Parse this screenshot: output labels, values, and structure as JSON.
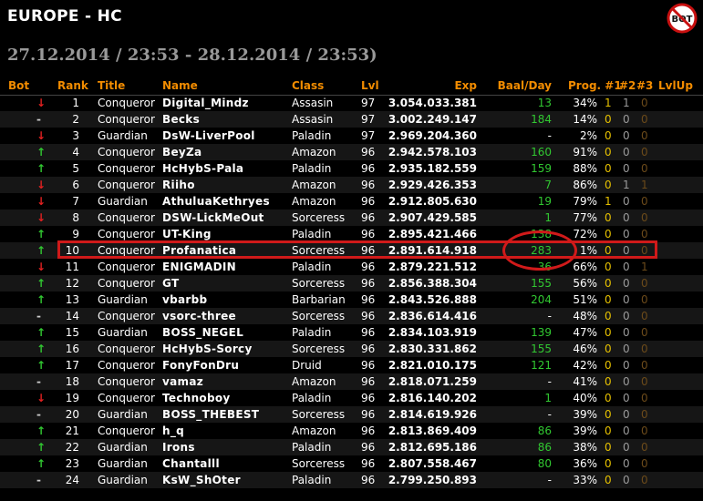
{
  "page": {
    "title": "EUROPE - HC",
    "date_range": "27.12.2014 / 23:53 - 28.12.2014 / 23:53)",
    "logo_text": "BOT",
    "logo_icon": "no-bot-icon"
  },
  "colors": {
    "header": "#f28c00",
    "up": "#31c831",
    "down": "#e02020",
    "baal": "#31c831",
    "highlight": "#d01a1a"
  },
  "table": {
    "headers": {
      "bot": "Bot",
      "rank": "Rank",
      "title": "Title",
      "name": "Name",
      "class": "Class",
      "lvl": "Lvl",
      "exp": "Exp",
      "baal_day": "Baal/Day",
      "prog1": "Prog. #1",
      "prog2": "#2",
      "prog3": "#3",
      "lvlup": "LvlUp"
    },
    "rows": [
      {
        "bot": "↓",
        "trend": "down",
        "rank": "1",
        "title": "Conqueror",
        "name": "Digital_Mindz",
        "class": "Assasin",
        "lvl": "97",
        "exp": "3.054.033.381",
        "baal": "13",
        "prog": "34%",
        "p1": "1",
        "p2": "1",
        "p3": "0"
      },
      {
        "bot": "-",
        "trend": "same",
        "rank": "2",
        "title": "Conqueror",
        "name": "Becks",
        "class": "Assasin",
        "lvl": "97",
        "exp": "3.002.249.147",
        "baal": "184",
        "prog": "14%",
        "p1": "0",
        "p2": "0",
        "p3": "0"
      },
      {
        "bot": "↓",
        "trend": "down",
        "rank": "3",
        "title": "Guardian",
        "name": "DsW-LiverPool",
        "class": "Paladin",
        "lvl": "97",
        "exp": "2.969.204.360",
        "baal": "-",
        "prog": "2%",
        "p1": "0",
        "p2": "0",
        "p3": "0"
      },
      {
        "bot": "↑",
        "trend": "up",
        "rank": "4",
        "title": "Conqueror",
        "name": "BeyZa",
        "class": "Amazon",
        "lvl": "96",
        "exp": "2.942.578.103",
        "baal": "160",
        "prog": "91%",
        "p1": "0",
        "p2": "0",
        "p3": "0"
      },
      {
        "bot": "↑",
        "trend": "up",
        "rank": "5",
        "title": "Conqueror",
        "name": "HcHybS-Pala",
        "class": "Paladin",
        "lvl": "96",
        "exp": "2.935.182.559",
        "baal": "159",
        "prog": "88%",
        "p1": "0",
        "p2": "0",
        "p3": "0"
      },
      {
        "bot": "↓",
        "trend": "down",
        "rank": "6",
        "title": "Conqueror",
        "name": "Riiho",
        "class": "Amazon",
        "lvl": "96",
        "exp": "2.929.426.353",
        "baal": "7",
        "prog": "86%",
        "p1": "0",
        "p2": "1",
        "p3": "1"
      },
      {
        "bot": "↓",
        "trend": "down",
        "rank": "7",
        "title": "Guardian",
        "name": "AthuluaKethryes",
        "class": "Amazon",
        "lvl": "96",
        "exp": "2.912.805.630",
        "baal": "19",
        "prog": "79%",
        "p1": "1",
        "p2": "0",
        "p3": "0"
      },
      {
        "bot": "↓",
        "trend": "down",
        "rank": "8",
        "title": "Conqueror",
        "name": "DSW-LickMeOut",
        "class": "Sorceress",
        "lvl": "96",
        "exp": "2.907.429.585",
        "baal": "1",
        "prog": "77%",
        "p1": "0",
        "p2": "0",
        "p3": "0"
      },
      {
        "bot": "↑",
        "trend": "up",
        "rank": "9",
        "title": "Conqueror",
        "name": "UT-King",
        "class": "Paladin",
        "lvl": "96",
        "exp": "2.895.421.466",
        "baal": "138",
        "prog": "72%",
        "p1": "0",
        "p2": "0",
        "p3": "0"
      },
      {
        "bot": "↑",
        "trend": "up",
        "rank": "10",
        "title": "Conqueror",
        "name": "Profanatica",
        "class": "Sorceress",
        "lvl": "96",
        "exp": "2.891.614.918",
        "baal": "283",
        "prog": "1%",
        "p1": "0",
        "p2": "0",
        "p3": "0"
      },
      {
        "bot": "↓",
        "trend": "down",
        "rank": "11",
        "title": "Conqueror",
        "name": "ENIGMADIN",
        "class": "Paladin",
        "lvl": "96",
        "exp": "2.879.221.512",
        "baal": "36",
        "prog": "66%",
        "p1": "0",
        "p2": "0",
        "p3": "1"
      },
      {
        "bot": "↑",
        "trend": "up",
        "rank": "12",
        "title": "Conqueror",
        "name": "GT",
        "class": "Sorceress",
        "lvl": "96",
        "exp": "2.856.388.304",
        "baal": "155",
        "prog": "56%",
        "p1": "0",
        "p2": "0",
        "p3": "0"
      },
      {
        "bot": "↑",
        "trend": "up",
        "rank": "13",
        "title": "Guardian",
        "name": "vbarbb",
        "class": "Barbarian",
        "lvl": "96",
        "exp": "2.843.526.888",
        "baal": "204",
        "prog": "51%",
        "p1": "0",
        "p2": "0",
        "p3": "0"
      },
      {
        "bot": "-",
        "trend": "same",
        "rank": "14",
        "title": "Conqueror",
        "name": "vsorc-three",
        "class": "Sorceress",
        "lvl": "96",
        "exp": "2.836.614.416",
        "baal": "-",
        "prog": "48%",
        "p1": "0",
        "p2": "0",
        "p3": "0"
      },
      {
        "bot": "↑",
        "trend": "up",
        "rank": "15",
        "title": "Guardian",
        "name": "BOSS_NEGEL",
        "class": "Paladin",
        "lvl": "96",
        "exp": "2.834.103.919",
        "baal": "139",
        "prog": "47%",
        "p1": "0",
        "p2": "0",
        "p3": "0"
      },
      {
        "bot": "↑",
        "trend": "up",
        "rank": "16",
        "title": "Conqueror",
        "name": "HcHybS-Sorcy",
        "class": "Sorceress",
        "lvl": "96",
        "exp": "2.830.331.862",
        "baal": "155",
        "prog": "46%",
        "p1": "0",
        "p2": "0",
        "p3": "0"
      },
      {
        "bot": "↑",
        "trend": "up",
        "rank": "17",
        "title": "Conqueror",
        "name": "FonyFonDru",
        "class": "Druid",
        "lvl": "96",
        "exp": "2.821.010.175",
        "baal": "121",
        "prog": "42%",
        "p1": "0",
        "p2": "0",
        "p3": "0"
      },
      {
        "bot": "-",
        "trend": "same",
        "rank": "18",
        "title": "Conqueror",
        "name": "vamaz",
        "class": "Amazon",
        "lvl": "96",
        "exp": "2.818.071.259",
        "baal": "-",
        "prog": "41%",
        "p1": "0",
        "p2": "0",
        "p3": "0"
      },
      {
        "bot": "↓",
        "trend": "down",
        "rank": "19",
        "title": "Conqueror",
        "name": "Technoboy",
        "class": "Paladin",
        "lvl": "96",
        "exp": "2.816.140.202",
        "baal": "1",
        "prog": "40%",
        "p1": "0",
        "p2": "0",
        "p3": "0"
      },
      {
        "bot": "-",
        "trend": "same",
        "rank": "20",
        "title": "Guardian",
        "name": "BOSS_THEBEST",
        "class": "Sorceress",
        "lvl": "96",
        "exp": "2.814.619.926",
        "baal": "-",
        "prog": "39%",
        "p1": "0",
        "p2": "0",
        "p3": "0"
      },
      {
        "bot": "↑",
        "trend": "up",
        "rank": "21",
        "title": "Conqueror",
        "name": "h_q",
        "class": "Amazon",
        "lvl": "96",
        "exp": "2.813.869.409",
        "baal": "86",
        "prog": "39%",
        "p1": "0",
        "p2": "0",
        "p3": "0"
      },
      {
        "bot": "↑",
        "trend": "up",
        "rank": "22",
        "title": "Guardian",
        "name": "Irons",
        "class": "Paladin",
        "lvl": "96",
        "exp": "2.812.695.186",
        "baal": "86",
        "prog": "38%",
        "p1": "0",
        "p2": "0",
        "p3": "0"
      },
      {
        "bot": "↑",
        "trend": "up",
        "rank": "23",
        "title": "Guardian",
        "name": "Chantalll",
        "class": "Sorceress",
        "lvl": "96",
        "exp": "2.807.558.467",
        "baal": "80",
        "prog": "36%",
        "p1": "0",
        "p2": "0",
        "p3": "0"
      },
      {
        "bot": "-",
        "trend": "same",
        "rank": "24",
        "title": "Guardian",
        "name": "KsW_ShOter",
        "class": "Paladin",
        "lvl": "96",
        "exp": "2.799.250.893",
        "baal": "-",
        "prog": "33%",
        "p1": "0",
        "p2": "0",
        "p3": "0"
      }
    ]
  }
}
